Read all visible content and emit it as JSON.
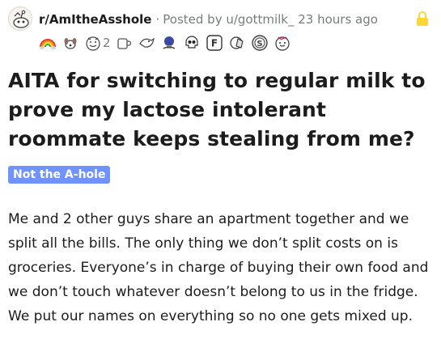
{
  "post": {
    "subreddit": "r/AmItheAsshole",
    "separator": "·",
    "posted_by": "Posted by u/gottmilk_ 23 hours ago",
    "title": "AITA for switching to regular milk to prove my lactose intolerant roommate keeps stealing from me?",
    "flair": "Not the A-hole",
    "body": "Me and 2 other guys share an apartment together and we split all the bills. The only thing we don’t split costs on is groceries. Everyone’s in charge of buying their own food and we don’t touch whatever doesn’t belong to us in the fridge. We put our names on everything so no one gets mixed up."
  },
  "awards": [
    {
      "icon": "rainbow-award-icon"
    },
    {
      "icon": "dog-award-icon"
    },
    {
      "icon": "wholesome-award-icon",
      "count": "2"
    },
    {
      "icon": "cup-award-icon"
    },
    {
      "icon": "bird-award-icon"
    },
    {
      "icon": "bulb-award-icon"
    },
    {
      "icon": "skull-award-icon"
    },
    {
      "icon": "press-f-award-icon"
    },
    {
      "icon": "facepalm-award-icon"
    },
    {
      "icon": "silver-award-icon"
    },
    {
      "icon": "hugz-award-icon"
    }
  ],
  "colors": {
    "flair_bg": "#7193ff",
    "lock": "#ffd635",
    "meta_text": "#787c7e"
  }
}
